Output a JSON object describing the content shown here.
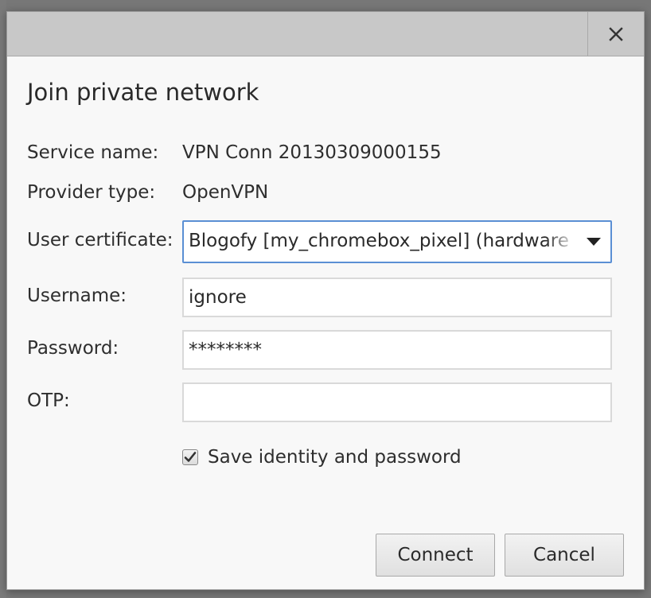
{
  "dialog": {
    "title": "Join private network",
    "close_icon": "close-icon"
  },
  "fields": {
    "service_name": {
      "label": "Service name:",
      "value": "VPN Conn 20130309000155"
    },
    "provider_type": {
      "label": "Provider type:",
      "value": "OpenVPN"
    },
    "user_certificate": {
      "label": "User certificate:",
      "value": "Blogofy [my_chromebox_pixel] (hardware-backed)"
    },
    "username": {
      "label": "Username:",
      "value": "ignore"
    },
    "password": {
      "label": "Password:",
      "value": "********"
    },
    "otp": {
      "label": "OTP:",
      "value": ""
    }
  },
  "save_identity": {
    "label": "Save identity and password",
    "checked": true
  },
  "buttons": {
    "connect": "Connect",
    "cancel": "Cancel"
  },
  "colors": {
    "focus_border": "#5a8fd4",
    "titlebar": "#c8c8c8"
  }
}
